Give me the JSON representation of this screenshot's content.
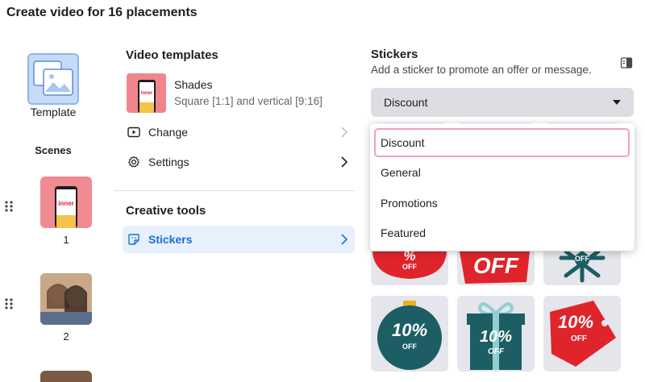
{
  "header": {
    "title": "Create video for 16 placements"
  },
  "left_rail": {
    "template_label": "Template",
    "scenes_label": "Scenes",
    "scenes": [
      {
        "number": "1",
        "thumb_text": "inner"
      },
      {
        "number": "2"
      },
      {
        "number": ""
      }
    ]
  },
  "video_templates": {
    "heading": "Video templates",
    "template_name": "Shades",
    "template_dims": "Square [1:1] and vertical [9:16]",
    "template_thumb_text": "inner",
    "change_label": "Change",
    "settings_label": "Settings"
  },
  "creative_tools": {
    "heading": "Creative tools",
    "stickers_label": "Stickers"
  },
  "stickers_panel": {
    "title": "Stickers",
    "subtitle": "Add a sticker to promote an offer or message.",
    "selected": "Discount",
    "options": [
      "Discount",
      "General",
      "Promotions",
      "Featured"
    ],
    "tiles": [
      {
        "text_main": "%",
        "text_sub": "OFF"
      },
      {
        "text_main": "OFF"
      },
      {
        "text_main": "",
        "text_sub": "OFF"
      },
      {
        "text_main": "10%",
        "text_sub": "OFF"
      },
      {
        "text_main": "10%",
        "text_sub": "OFF"
      },
      {
        "text_main": "10%",
        "text_sub": "OFF"
      }
    ]
  },
  "colors": {
    "accent": "#1a6ed8",
    "active_row_bg": "#e7f0fd",
    "sticker_red": "#e0242c",
    "sticker_teal": "#1d5d64",
    "selected_outline": "#f1a0bb"
  }
}
